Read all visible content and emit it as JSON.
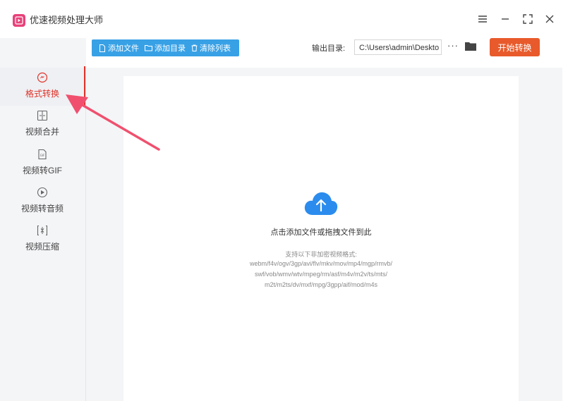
{
  "app": {
    "title": "优速视频处理大师"
  },
  "window_controls": [
    "menu-icon",
    "minimize-icon",
    "fullscreen-icon",
    "close-icon"
  ],
  "sidebar": {
    "items": [
      {
        "label": "格式转换",
        "icon": "format-convert-icon",
        "active": true
      },
      {
        "label": "视频合并",
        "icon": "merge-icon",
        "active": false
      },
      {
        "label": "视频转GIF",
        "icon": "gif-icon",
        "active": false
      },
      {
        "label": "视频转音频",
        "icon": "audio-icon",
        "active": false
      },
      {
        "label": "视频压缩",
        "icon": "compress-icon",
        "active": false
      }
    ]
  },
  "toolbar": {
    "add_file": "添加文件",
    "add_folder": "添加目录",
    "clear_list": "清除列表",
    "output_label": "输出目录:",
    "output_path": "C:\\Users\\admin\\Deskto",
    "more": "···",
    "start": "开始转换"
  },
  "dropzone": {
    "hint": "点击添加文件或拖拽文件到此",
    "formats_title": "支持以下非加密视频格式:",
    "formats_lines": [
      "webm/f4v/ogv/3gp/avi/flv/mkv/mov/mp4/mgp/rmvb/",
      "swf/vob/wmv/wtv/mpeg/rm/asf/m4v/m2v/ts/mts/",
      "m2t/m2ts/dv/mxf/mpg/3gpp/aif/mod/m4s"
    ]
  },
  "colors": {
    "accent_blue": "#38a1e6",
    "start_orange": "#e85a2b",
    "active_red": "#e0332a",
    "app_icon_pink": "#e8417a",
    "annotation_arrow": "#f0506e"
  }
}
